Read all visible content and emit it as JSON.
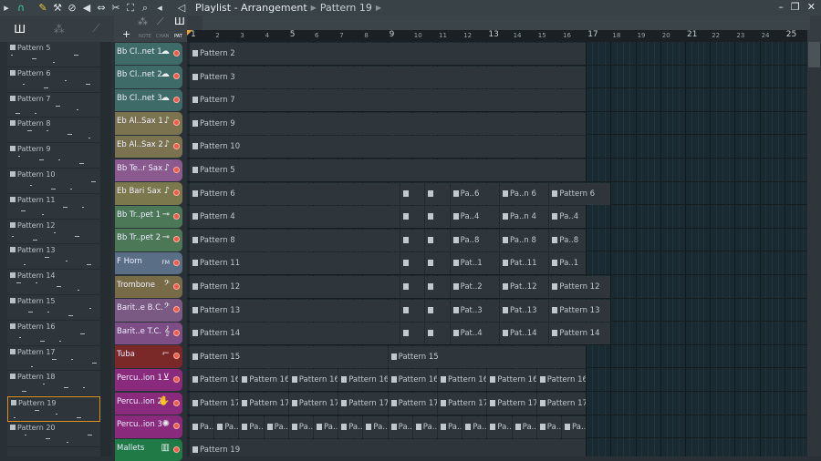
{
  "titlebar": {
    "title": "Playlist - Arrangement",
    "pattern": "Pattern 19",
    "icons": [
      "play-arrow-icon",
      "magnet-icon",
      "pencil-icon",
      "paint-icon",
      "delete-icon",
      "mute-icon",
      "slip-icon",
      "slice-icon",
      "select-icon",
      "zoom-icon",
      "playback-icon"
    ],
    "window": [
      "minimize-icon",
      "restore-icon",
      "close-icon"
    ]
  },
  "tool_labels": {
    "add": "+",
    "note": "NOTE",
    "chan": "CHAN",
    "pat": "PAT"
  },
  "ruler": [
    1,
    2,
    3,
    4,
    5,
    6,
    7,
    8,
    9,
    10,
    11,
    12,
    13,
    14,
    15,
    16,
    17,
    18,
    19,
    20,
    21,
    22,
    23,
    24,
    25
  ],
  "picker": {
    "selected": "Pattern 19",
    "items": [
      "Pattern 5",
      "Pattern 6",
      "Pattern 7",
      "Pattern 8",
      "Pattern 9",
      "Pattern 10",
      "Pattern 11",
      "Pattern 12",
      "Pattern 13",
      "Pattern 14",
      "Pattern 15",
      "Pattern 16",
      "Pattern 17",
      "Pattern 18",
      "Pattern 19",
      "Pattern 20"
    ]
  },
  "song_end_bar": 17,
  "tracks": [
    {
      "name": "Bb Cl..net 1",
      "icon": "clarinet-icon",
      "color": "#3e6a67",
      "clips": [
        [
          1,
          16,
          "Pattern 2"
        ]
      ]
    },
    {
      "name": "Bb Cl..net 2",
      "icon": "clarinet-icon",
      "color": "#3e6a67",
      "clips": [
        [
          1,
          16,
          "Pattern 3"
        ]
      ]
    },
    {
      "name": "Bb Cl..net 3",
      "icon": "clarinet-icon",
      "color": "#3e6a67",
      "clips": [
        [
          1,
          16,
          "Pattern 7"
        ]
      ]
    },
    {
      "name": "Eb Al..Sax 1",
      "icon": "sax-icon",
      "color": "#7b7350",
      "clips": [
        [
          1,
          16,
          "Pattern 9"
        ]
      ]
    },
    {
      "name": "Eb Al..Sax 2",
      "icon": "sax-icon",
      "color": "#7b7350",
      "clips": [
        [
          1,
          16,
          "Pattern 10"
        ]
      ]
    },
    {
      "name": "Bb Te..r Sax",
      "icon": "sax-icon",
      "color": "#8a5a8e",
      "clips": [
        [
          1,
          16,
          "Pattern 5"
        ]
      ]
    },
    {
      "name": "Eb Bari Sax",
      "icon": "sax-icon",
      "color": "#7a784c",
      "clips": [
        [
          1,
          8.5,
          "Pattern 6"
        ],
        [
          9.5,
          1,
          ""
        ],
        [
          10.5,
          1,
          ""
        ],
        [
          11.5,
          2,
          "Pa..6"
        ],
        [
          13.5,
          2,
          "Pa..n 6"
        ],
        [
          15.5,
          2.5,
          "Pattern 6"
        ]
      ]
    },
    {
      "name": "Bb Tr..pet 1",
      "icon": "trumpet-icon",
      "color": "#4d7858",
      "clips": [
        [
          1,
          8.5,
          "Pattern 4"
        ],
        [
          9.5,
          1,
          ""
        ],
        [
          10.5,
          1,
          ""
        ],
        [
          11.5,
          2,
          "Pa..4"
        ],
        [
          13.5,
          2,
          "Pa..n 4"
        ],
        [
          15.5,
          1.5,
          "Pa..4"
        ]
      ]
    },
    {
      "name": "Bb Tr..pet 2",
      "icon": "trumpet-icon",
      "color": "#4d7858",
      "clips": [
        [
          1,
          8.5,
          "Pattern 8"
        ],
        [
          9.5,
          1,
          ""
        ],
        [
          10.5,
          1,
          ""
        ],
        [
          11.5,
          2,
          "Pa..8"
        ],
        [
          13.5,
          2,
          "Pa..n 8"
        ],
        [
          15.5,
          1.5,
          "Pa..8"
        ]
      ]
    },
    {
      "name": "F Horn",
      "icon": "fm-icon",
      "color": "#5a6f86",
      "clips": [
        [
          1,
          8.5,
          "Pattern 11"
        ],
        [
          9.5,
          1,
          ""
        ],
        [
          10.5,
          1,
          ""
        ],
        [
          11.5,
          2,
          "Pat..1"
        ],
        [
          13.5,
          2,
          "Pat..11"
        ],
        [
          15.5,
          1.5,
          "Pa..1"
        ]
      ]
    },
    {
      "name": "Trombone",
      "icon": "bass-clef-icon",
      "color": "#786c48",
      "clips": [
        [
          1,
          8.5,
          "Pattern 12"
        ],
        [
          9.5,
          1,
          ""
        ],
        [
          10.5,
          1,
          ""
        ],
        [
          11.5,
          2,
          "Pat..2"
        ],
        [
          13.5,
          2,
          "Pat..12"
        ],
        [
          15.5,
          2.5,
          "Pattern 12"
        ]
      ]
    },
    {
      "name": "Barit..e B.C.",
      "icon": "bass-clef-icon",
      "color": "#7a5a82",
      "clips": [
        [
          1,
          8.5,
          "Pattern 13"
        ],
        [
          9.5,
          1,
          ""
        ],
        [
          10.5,
          1,
          ""
        ],
        [
          11.5,
          2,
          "Pat..3"
        ],
        [
          13.5,
          2,
          "Pat..13"
        ],
        [
          15.5,
          2.5,
          "Pattern 13"
        ]
      ]
    },
    {
      "name": "Barit..e T.C.",
      "icon": "treble-clef-icon",
      "color": "#7d4e86",
      "clips": [
        [
          1,
          8.5,
          "Pattern 14"
        ],
        [
          9.5,
          1,
          ""
        ],
        [
          10.5,
          1,
          ""
        ],
        [
          11.5,
          2,
          "Pat..4"
        ],
        [
          13.5,
          2,
          "Pat..14"
        ],
        [
          15.5,
          2.5,
          "Pattern 14"
        ]
      ]
    },
    {
      "name": "Tuba",
      "icon": "tuba-icon",
      "color": "#7a2828",
      "clips": [
        [
          1,
          8,
          "Pattern 15"
        ],
        [
          9,
          8,
          "Pattern 15"
        ]
      ]
    },
    {
      "name": "Percu..ion 1",
      "icon": "drum-icon",
      "color": "#8a2a7c",
      "clips": [
        [
          1,
          2,
          "Pattern 16"
        ],
        [
          3,
          2,
          "Pattern 16"
        ],
        [
          5,
          2,
          "Pattern 16"
        ],
        [
          7,
          2,
          "Pattern 16"
        ],
        [
          9,
          2,
          "Pattern 16"
        ],
        [
          11,
          2,
          "Pattern 16"
        ],
        [
          13,
          2,
          "Pattern 16"
        ],
        [
          15,
          2,
          "Pattern 16"
        ]
      ]
    },
    {
      "name": "Percu..ion 2",
      "icon": "clap-icon",
      "color": "#8a2a7c",
      "clips": [
        [
          1,
          2,
          "Pattern 17"
        ],
        [
          3,
          2,
          "Pattern 17"
        ],
        [
          5,
          2,
          "Pattern 17"
        ],
        [
          7,
          2,
          "Pattern 17"
        ],
        [
          9,
          2,
          "Pattern 17"
        ],
        [
          11,
          2,
          "Pattern 17"
        ],
        [
          13,
          2,
          "Pattern 17"
        ],
        [
          15,
          2,
          "Pattern 17"
        ]
      ]
    },
    {
      "name": "Percu..ion 3",
      "icon": "tambourine-icon",
      "color": "#8a2a7c",
      "clips": [
        [
          1,
          1,
          "Pa.."
        ],
        [
          2,
          1,
          "Pa.."
        ],
        [
          3,
          1,
          "Pa.."
        ],
        [
          4,
          1,
          "Pa.."
        ],
        [
          5,
          1,
          "Pa.."
        ],
        [
          6,
          1,
          "Pa.."
        ],
        [
          7,
          1,
          "Pa.."
        ],
        [
          8,
          1,
          "Pa.."
        ],
        [
          9,
          1,
          "Pa.."
        ],
        [
          10,
          1,
          "Pa.."
        ],
        [
          11,
          1,
          "Pa.."
        ],
        [
          12,
          1,
          "Pa.."
        ],
        [
          13,
          1,
          "Pa.."
        ],
        [
          14,
          1,
          "Pa.."
        ],
        [
          15,
          1,
          "Pa.."
        ],
        [
          16,
          1,
          "Pa.."
        ]
      ]
    },
    {
      "name": "Mallets",
      "icon": "mallets-icon",
      "color": "#1f7a45",
      "clips": [
        [
          1,
          16,
          "Pattern 19"
        ]
      ]
    }
  ]
}
